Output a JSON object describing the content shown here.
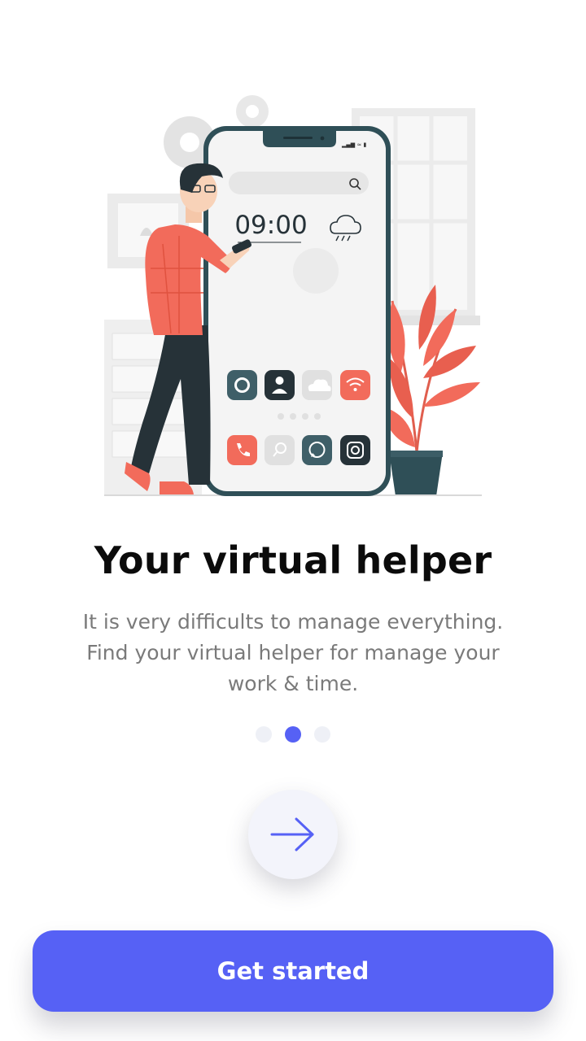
{
  "onboarding": {
    "title": "Your virtual helper",
    "subtitle": "It is very difficults to manage everything. Find your virtual helper for manage your work & time.",
    "page_indicator": {
      "total": 3,
      "active_index": 1
    },
    "next_icon": "arrow-right-icon",
    "cta_label": "Get started"
  },
  "illustration": {
    "phone_clock": "09:00",
    "weather_icon": "rain-cloud-icon",
    "app_icons": [
      "settings-icon",
      "contact-icon",
      "cloud-icon",
      "wifi-icon",
      "phone-icon",
      "search-icon",
      "whatsapp-icon",
      "instagram-icon"
    ]
  },
  "colors": {
    "accent": "#5661f5",
    "coral": "#f26b5b",
    "dark_teal": "#2f4f57",
    "inactive_dot": "#eef0f6"
  }
}
